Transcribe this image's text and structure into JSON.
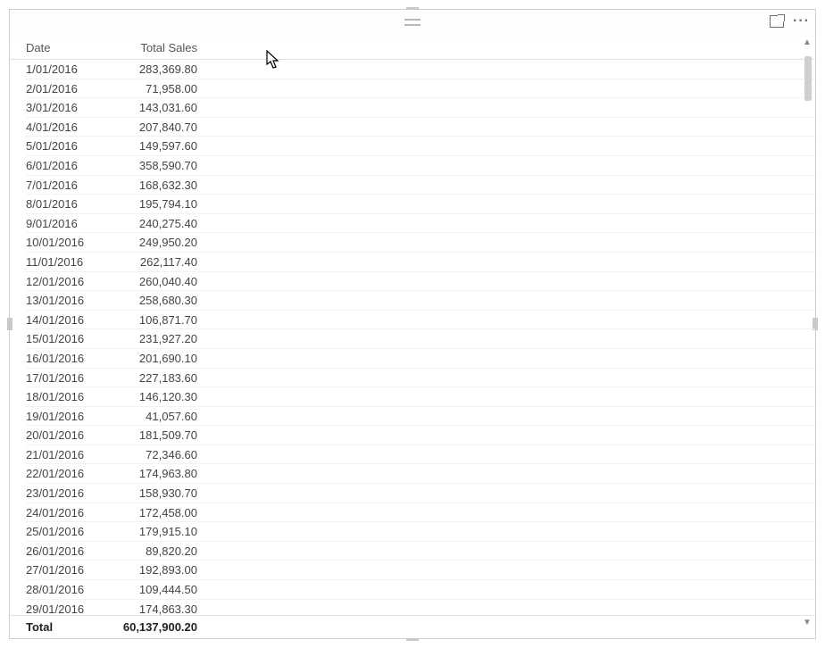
{
  "columns": {
    "date_header": "Date",
    "sales_header": "Total Sales"
  },
  "rows": [
    {
      "date": "1/01/2016",
      "sales": "283,369.80"
    },
    {
      "date": "2/01/2016",
      "sales": "71,958.00"
    },
    {
      "date": "3/01/2016",
      "sales": "143,031.60"
    },
    {
      "date": "4/01/2016",
      "sales": "207,840.70"
    },
    {
      "date": "5/01/2016",
      "sales": "149,597.60"
    },
    {
      "date": "6/01/2016",
      "sales": "358,590.70"
    },
    {
      "date": "7/01/2016",
      "sales": "168,632.30"
    },
    {
      "date": "8/01/2016",
      "sales": "195,794.10"
    },
    {
      "date": "9/01/2016",
      "sales": "240,275.40"
    },
    {
      "date": "10/01/2016",
      "sales": "249,950.20"
    },
    {
      "date": "11/01/2016",
      "sales": "262,117.40"
    },
    {
      "date": "12/01/2016",
      "sales": "260,040.40"
    },
    {
      "date": "13/01/2016",
      "sales": "258,680.30"
    },
    {
      "date": "14/01/2016",
      "sales": "106,871.70"
    },
    {
      "date": "15/01/2016",
      "sales": "231,927.20"
    },
    {
      "date": "16/01/2016",
      "sales": "201,690.10"
    },
    {
      "date": "17/01/2016",
      "sales": "227,183.60"
    },
    {
      "date": "18/01/2016",
      "sales": "146,120.30"
    },
    {
      "date": "19/01/2016",
      "sales": "41,057.60"
    },
    {
      "date": "20/01/2016",
      "sales": "181,509.70"
    },
    {
      "date": "21/01/2016",
      "sales": "72,346.60"
    },
    {
      "date": "22/01/2016",
      "sales": "174,963.80"
    },
    {
      "date": "23/01/2016",
      "sales": "158,930.70"
    },
    {
      "date": "24/01/2016",
      "sales": "172,458.00"
    },
    {
      "date": "25/01/2016",
      "sales": "179,915.10"
    },
    {
      "date": "26/01/2016",
      "sales": "89,820.20"
    },
    {
      "date": "27/01/2016",
      "sales": "192,893.00"
    },
    {
      "date": "28/01/2016",
      "sales": "109,444.50"
    },
    {
      "date": "29/01/2016",
      "sales": "174,863.30"
    }
  ],
  "total": {
    "label": "Total",
    "value": "60,137,900.20"
  },
  "chart_data": {
    "type": "table",
    "title": "",
    "columns": [
      "Date",
      "Total Sales"
    ],
    "rows": [
      [
        "1/01/2016",
        283369.8
      ],
      [
        "2/01/2016",
        71958.0
      ],
      [
        "3/01/2016",
        143031.6
      ],
      [
        "4/01/2016",
        207840.7
      ],
      [
        "5/01/2016",
        149597.6
      ],
      [
        "6/01/2016",
        358590.7
      ],
      [
        "7/01/2016",
        168632.3
      ],
      [
        "8/01/2016",
        195794.1
      ],
      [
        "9/01/2016",
        240275.4
      ],
      [
        "10/01/2016",
        249950.2
      ],
      [
        "11/01/2016",
        262117.4
      ],
      [
        "12/01/2016",
        260040.4
      ],
      [
        "13/01/2016",
        258680.3
      ],
      [
        "14/01/2016",
        106871.7
      ],
      [
        "15/01/2016",
        231927.2
      ],
      [
        "16/01/2016",
        201690.1
      ],
      [
        "17/01/2016",
        227183.6
      ],
      [
        "18/01/2016",
        146120.3
      ],
      [
        "19/01/2016",
        41057.6
      ],
      [
        "20/01/2016",
        181509.7
      ],
      [
        "21/01/2016",
        72346.6
      ],
      [
        "22/01/2016",
        174963.8
      ],
      [
        "23/01/2016",
        158930.7
      ],
      [
        "24/01/2016",
        172458.0
      ],
      [
        "25/01/2016",
        179915.1
      ],
      [
        "26/01/2016",
        89820.2
      ],
      [
        "27/01/2016",
        192893.0
      ],
      [
        "28/01/2016",
        109444.5
      ],
      [
        "29/01/2016",
        174863.3
      ]
    ],
    "total": [
      "Total",
      60137900.2
    ]
  }
}
